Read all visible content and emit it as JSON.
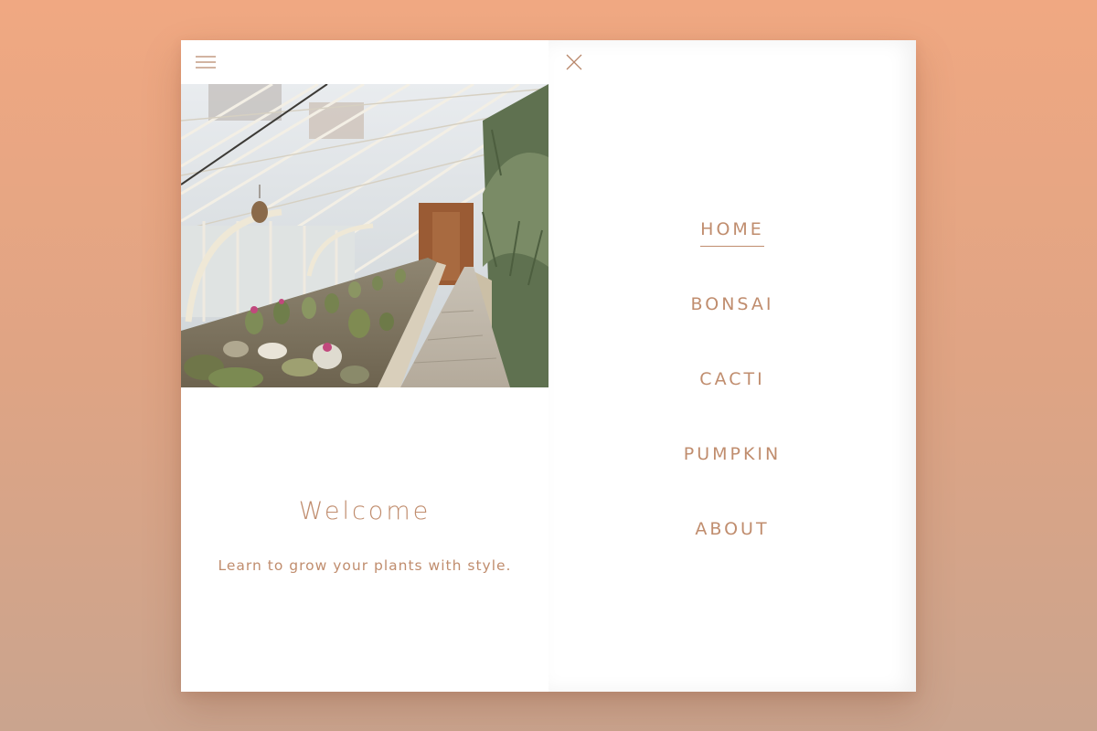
{
  "colors": {
    "accent": "#c08d6e",
    "background_top": "#f0a882",
    "background_bottom": "#caa48e",
    "panel": "#ffffff"
  },
  "left_panel": {
    "menu_icon": "hamburger-menu-icon",
    "hero_image": "greenhouse-cactus-photo",
    "title": "Welcome",
    "subtitle": "Learn to grow your plants with style."
  },
  "right_panel": {
    "close_icon": "close-x-icon",
    "nav": [
      {
        "label": "HOME",
        "active": true
      },
      {
        "label": "BONSAI",
        "active": false
      },
      {
        "label": "CACTI",
        "active": false
      },
      {
        "label": "PUMPKIN",
        "active": false
      },
      {
        "label": "ABOUT",
        "active": false
      }
    ]
  }
}
